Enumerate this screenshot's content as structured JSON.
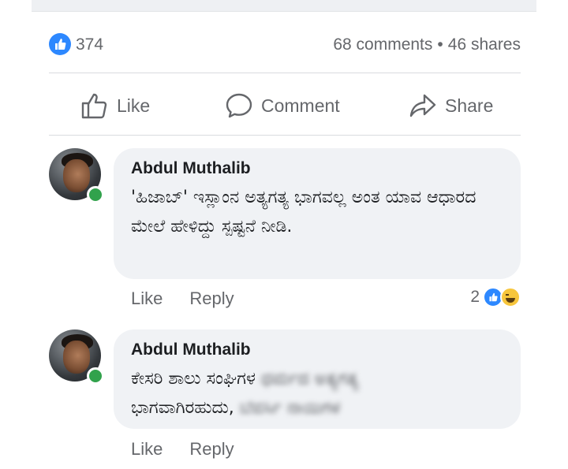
{
  "post": {
    "reactions": {
      "count": "374",
      "icon": "like-icon",
      "color": "#2d88ff"
    },
    "comments_count": "68 comments",
    "separator": "•",
    "shares_count": "46 shares"
  },
  "actions": {
    "like_label": "Like",
    "comment_label": "Comment",
    "share_label": "Share"
  },
  "comments": [
    {
      "author": "Abdul Muthalib",
      "text": "'ಹಿಜಾಬ್' ಇಸ್ಲಾಂನ ಅತ್ಯಗತ್ಯ ಭಾಗವಲ್ಲ ಅಂತ ಯಾವ ಆಧಾರದ ಮೇಲೆ ಹೇಳಿದ್ದು ಸ್ಪಷ್ಟನೆ ನೀಡಿ.",
      "like_label": "Like",
      "reply_label": "Reply",
      "reaction_count": "2",
      "reaction_icons": [
        "like-icon",
        "haha-icon"
      ],
      "online": true
    },
    {
      "author": "Abdul Muthalib",
      "text_visible": "ಕೇಸರಿ ಶಾಲು ಸಂಘಿಗಳ",
      "text_blurred": "ಧರ್ಮದ ಅತ್ಯಗತ್ಯ",
      "text_line2": "ಭಾಗವಾಗಿರಹುದು,",
      "text_line2_blurred": "ಬೆವರ್ಸಿ ನಾಯಿಗಳ",
      "like_label": "Like",
      "reply_label": "Reply",
      "online": true
    }
  ],
  "colors": {
    "accent": "#2d88ff",
    "muted": "#65676b",
    "bubble": "#f0f2f5",
    "online": "#31a24c"
  }
}
